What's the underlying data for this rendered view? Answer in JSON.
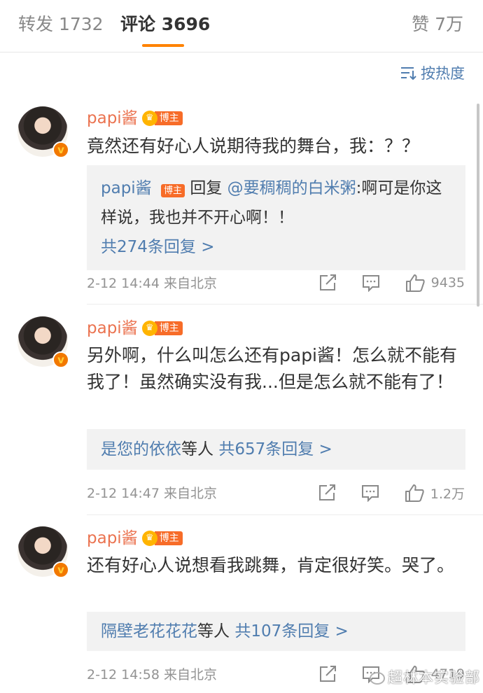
{
  "tabs": {
    "repost": "转发 1732",
    "comment": "评论 3696",
    "like": "赞 7万"
  },
  "accent_color": "#ff8200",
  "sort": {
    "label": "按热度",
    "icon": "sort-icon"
  },
  "comments": [
    {
      "user": "papi酱",
      "badge": "博主",
      "text": "竟然还有好心人说期待我的舞台，我：？？",
      "reply": {
        "user": "papi酱",
        "badge": "博主",
        "verb": "回复",
        "target": "@要稠稠的白米粥",
        "text": ":啊可是你这样说，我也并不开心啊！！",
        "more": "共274条回复 >"
      },
      "time": "2-12 14:44",
      "location": "来自北京",
      "likes": "9435"
    },
    {
      "user": "papi酱",
      "badge": "博主",
      "text": "另外啊，什么叫怎么还有papi酱！怎么就不能有我了！虽然确实没有我...但是怎么就不能有了！",
      "reply_summary": {
        "names": "是您的依依",
        "suffix": "等人",
        "count": "共657条回复 >"
      },
      "time": "2-12 14:47",
      "location": "来自北京",
      "likes": "1.2万"
    },
    {
      "user": "papi酱",
      "badge": "博主",
      "text": "还有好心人说想看我跳舞，肯定很好笑。哭了。",
      "reply_summary": {
        "names": "隔壁老花花花",
        "suffix": "等人",
        "count": "共107条回复 >"
      },
      "time": "2-12 14:58",
      "location": "来自北京",
      "likes": "4719"
    }
  ],
  "watermark": "超林本实验部"
}
